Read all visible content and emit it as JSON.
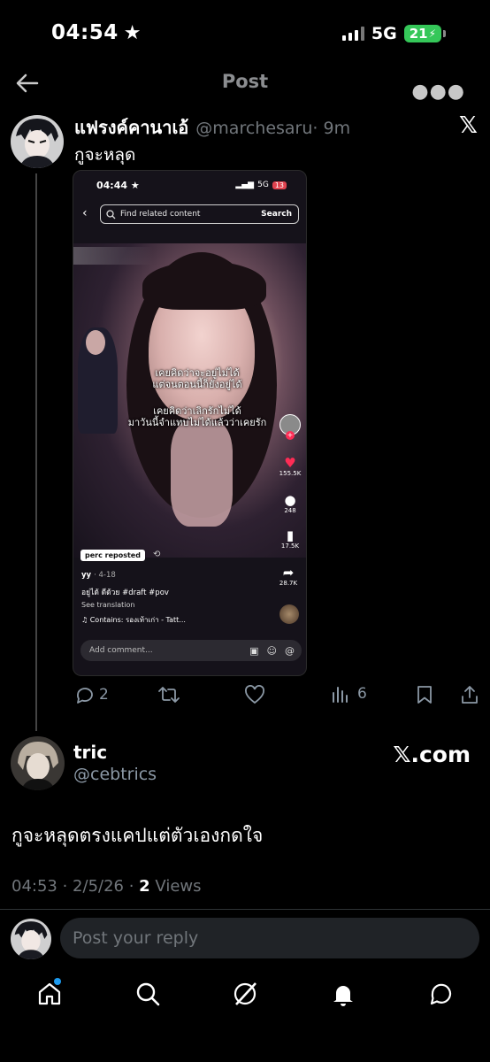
{
  "status_bar": {
    "time": "04:54",
    "network": "5G",
    "battery": "21"
  },
  "header": {
    "title": "Post"
  },
  "tweet": {
    "author_name": "แฟรงค์คานาเอ้",
    "author_handle": "@marchesaru",
    "time_ago": "· 9m",
    "platform_badge": "𝕏",
    "text": "กูจะหลุด",
    "stats": {
      "replies": "2",
      "reposts": "",
      "likes": "",
      "views": "6"
    }
  },
  "embedded_screenshot": {
    "time": "04:44",
    "network": "5G",
    "battery": "13",
    "search_placeholder": "Find related content",
    "search_button": "Search",
    "caption_1": "เคยคิดว่าจะอยู่ไม่ได้\nแต่จนตอนนี้ก็ยังอยู่ได้",
    "caption_2": "เคยคิดว่าเลิกรักไม่ได้\nมาวันนี้จำแทบไม่ได้แล้วว่าเคยรัก",
    "likes": "155.5K",
    "comments": "248",
    "saves": "17.5K",
    "shares": "28.7K",
    "repost_label": "perc reposted",
    "user": "yy",
    "date": "· 4-18",
    "description": "อยู่ได้ ดีด้วย #draft #pov",
    "see_translation": "See translation",
    "sound": "♫ Contains: รองเท้าเก่า - Tatt...",
    "comment_placeholder": "Add comment..."
  },
  "quoted": {
    "name": "tric",
    "handle": "@cebtrics",
    "source": "𝕏.com",
    "text": "กูจะหลุดตรงแคปแต่ตัวเองกดใจ",
    "time": "04:53",
    "date": "2/5/26",
    "views_count": "2",
    "views_label": "Views"
  },
  "reply": {
    "placeholder": "Post your reply"
  },
  "nav": {
    "items": [
      "home-icon",
      "search-icon",
      "grok-icon",
      "notifications-icon",
      "messages-icon"
    ]
  }
}
